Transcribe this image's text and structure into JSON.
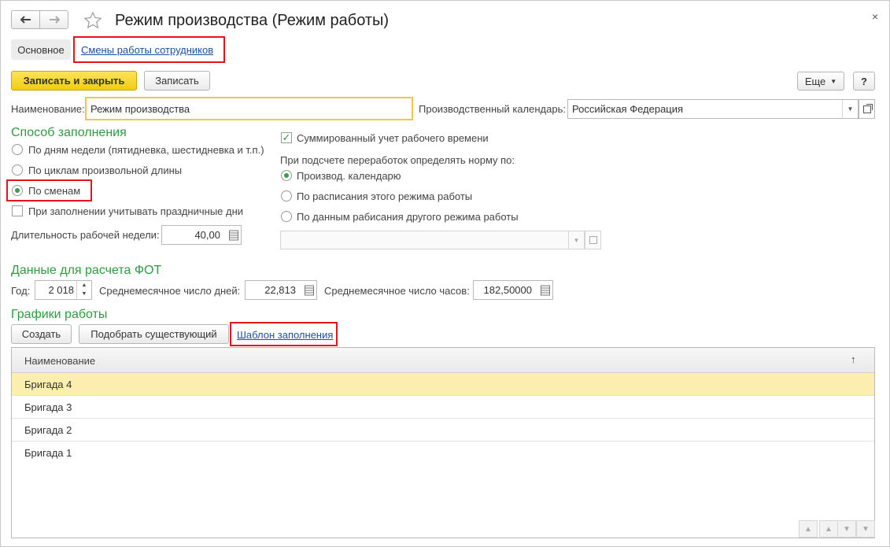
{
  "window": {
    "title": "Режим производства (Режим работы)",
    "close": "×"
  },
  "tabs": [
    {
      "label": "Основное"
    },
    {
      "label": "Смены работы сотрудников"
    }
  ],
  "toolbar": {
    "save_close": "Записать и закрыть",
    "save": "Записать",
    "more": "Еще",
    "help": "?"
  },
  "form": {
    "name_label": "Наименование:",
    "name_value": "Режим производства",
    "calendar_label": "Производственный календарь:",
    "calendar_value": "Российская Федерация"
  },
  "fill_method": {
    "title": "Способ заполнения",
    "options": [
      {
        "label": "По дням недели (пятидневка, шестидневка и т.п.)",
        "selected": false
      },
      {
        "label": "По циклам произвольной длины",
        "selected": false
      },
      {
        "label": "По сменам",
        "selected": true
      }
    ],
    "holidays_label": "При заполнении учитывать праздничные дни",
    "holidays_checked": false,
    "week_label": "Длительность рабочей недели:",
    "week_value": "40,00"
  },
  "summary": {
    "summed_label": "Суммированный учет рабочего времени",
    "summed_checked": true,
    "norm_label": "При подсчете переработок определять норму по:",
    "options": [
      {
        "label": "Производ. календарю",
        "selected": true
      },
      {
        "label": "По расписания этого режима работы",
        "selected": false
      },
      {
        "label": "По данным рабисания другого режима работы",
        "selected": false
      }
    ],
    "other_mode_value": ""
  },
  "fot": {
    "title": "Данные для расчета ФОТ",
    "year_label": "Год:",
    "year_value": "2 018",
    "days_label": "Среднемесячное число дней:",
    "days_value": "22,813",
    "hours_label": "Среднемесячное число часов:",
    "hours_value": "182,50000"
  },
  "schedules": {
    "title": "Графики работы",
    "create": "Создать",
    "pick": "Подобрать существующий",
    "template": "Шаблон заполнения",
    "column": "Наименование",
    "sort_icon": "↑",
    "rows": [
      "Бригада 4",
      "Бригада 3",
      "Бригада 2",
      "Бригада 1"
    ]
  },
  "colors": {
    "accent_green": "#2f9a41",
    "highlight_red": "#e3141c",
    "primary_yellow": "#f5d326",
    "selected_row": "#fbeeaf"
  }
}
